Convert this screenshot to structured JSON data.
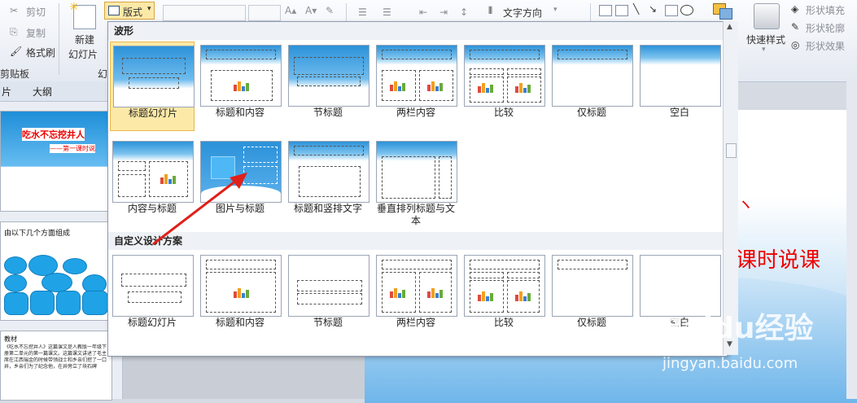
{
  "ribbon": {
    "cut": "剪切",
    "copy": "复制",
    "format_painter": "格式刷",
    "clipboard_group": "剪贴板",
    "new_slide_line1": "新建",
    "new_slide_line2": "幻灯片",
    "slides_group": "幻",
    "layout_button": "版式",
    "text_direction": "文字方向",
    "quick_styles": "快速样式",
    "shape_fill": "形状填充",
    "shape_outline": "形状轮廓",
    "shape_effects": "形状效果"
  },
  "left_panel": {
    "tab_slides": "片",
    "tab_outline": "大纲",
    "slide1_title": "吃水不忘挖井人",
    "slide1_sub": "——第一课时说",
    "slide2_title": "由以下几个方面组成",
    "slide3_title": "教材",
    "slide3_text": "《吃水不忘挖井人》这篇课文是人教版一年级下册第二单元的第一篇课文。这篇课文讲述了毛主席在江西瑞金的时候带领战士和乡亲们挖了一口井，乡亲们为了纪念他，在井旁立了块石碑"
  },
  "dropdown": {
    "section1": "波形",
    "section2": "自定义设计方案",
    "layouts1": [
      "标题幻灯片",
      "标题和内容",
      "节标题",
      "两栏内容",
      "比较",
      "仅标题",
      "空白",
      "内容与标题",
      "图片与标题",
      "标题和竖排文字",
      "垂直排列标题与文本"
    ],
    "layouts2": [
      "标题幻灯片",
      "标题和内容",
      "节标题",
      "两栏内容",
      "比较",
      "仅标题",
      "空白"
    ]
  },
  "slide": {
    "partial_title": "课时说课"
  },
  "watermark": {
    "brand": "Baidu经验",
    "url": "jingyan.baidu.com"
  },
  "colors": {
    "accent_blue": "#1e8ed8",
    "selected_bg": "#fde9a7",
    "arrow_red": "#e0201a"
  }
}
